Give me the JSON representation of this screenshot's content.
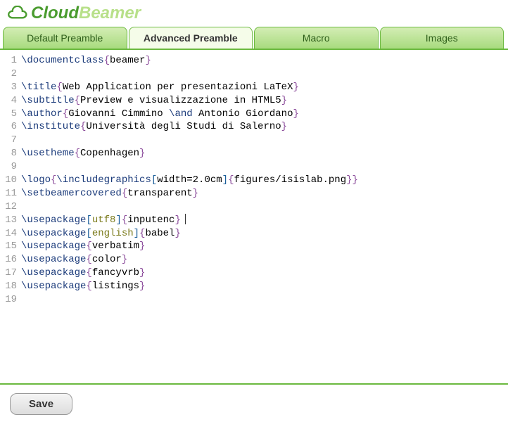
{
  "app": {
    "name_part1": "Cloud",
    "name_part2": "Beamer"
  },
  "tabs": [
    {
      "label": "Default Preamble",
      "active": false
    },
    {
      "label": "Advanced Preamble",
      "active": true
    },
    {
      "label": "Macro",
      "active": false
    },
    {
      "label": "Images",
      "active": false
    }
  ],
  "editor": {
    "line_count": 19,
    "lines": [
      [
        {
          "t": "cmd",
          "v": "\\documentclass"
        },
        {
          "t": "brace",
          "v": "{"
        },
        {
          "t": "txt",
          "v": "beamer"
        },
        {
          "t": "brace",
          "v": "}"
        }
      ],
      [],
      [
        {
          "t": "cmd",
          "v": "\\title"
        },
        {
          "t": "brace",
          "v": "{"
        },
        {
          "t": "txt",
          "v": "Web Application per presentazioni LaTeX"
        },
        {
          "t": "brace",
          "v": "}"
        }
      ],
      [
        {
          "t": "cmd",
          "v": "\\subtitle"
        },
        {
          "t": "brace",
          "v": "{"
        },
        {
          "t": "txt",
          "v": "Preview e visualizzazione in HTML5"
        },
        {
          "t": "brace",
          "v": "}"
        }
      ],
      [
        {
          "t": "cmd",
          "v": "\\author"
        },
        {
          "t": "brace",
          "v": "{"
        },
        {
          "t": "txt",
          "v": "Giovanni Cimmino "
        },
        {
          "t": "cmd",
          "v": "\\and"
        },
        {
          "t": "txt",
          "v": " Antonio Giordano"
        },
        {
          "t": "brace",
          "v": "}"
        }
      ],
      [
        {
          "t": "cmd",
          "v": "\\institute"
        },
        {
          "t": "brace",
          "v": "{"
        },
        {
          "t": "txt",
          "v": "Università degli Studi di Salerno"
        },
        {
          "t": "brace",
          "v": "}"
        }
      ],
      [],
      [
        {
          "t": "cmd",
          "v": "\\usetheme"
        },
        {
          "t": "brace",
          "v": "{"
        },
        {
          "t": "txt",
          "v": "Copenhagen"
        },
        {
          "t": "brace",
          "v": "}"
        }
      ],
      [],
      [
        {
          "t": "cmd",
          "v": "\\logo"
        },
        {
          "t": "brace",
          "v": "{"
        },
        {
          "t": "cmd",
          "v": "\\includegraphics"
        },
        {
          "t": "bracket",
          "v": "["
        },
        {
          "t": "txt",
          "v": "width=2.0cm"
        },
        {
          "t": "bracket",
          "v": "]"
        },
        {
          "t": "brace",
          "v": "{"
        },
        {
          "t": "txt",
          "v": "figures/isislab.png"
        },
        {
          "t": "brace",
          "v": "}"
        },
        {
          "t": "brace",
          "v": "}"
        }
      ],
      [
        {
          "t": "cmd",
          "v": "\\setbeamercovered"
        },
        {
          "t": "brace",
          "v": "{"
        },
        {
          "t": "txt",
          "v": "transparent"
        },
        {
          "t": "brace",
          "v": "}"
        }
      ],
      [],
      [
        {
          "t": "cmd",
          "v": "\\usepackage"
        },
        {
          "t": "bracket",
          "v": "["
        },
        {
          "t": "opt",
          "v": "utf8"
        },
        {
          "t": "bracket",
          "v": "]"
        },
        {
          "t": "brace",
          "v": "{"
        },
        {
          "t": "txt",
          "v": "inputenc"
        },
        {
          "t": "brace",
          "v": "}"
        },
        {
          "t": "cursor",
          "v": ""
        }
      ],
      [
        {
          "t": "cmd",
          "v": "\\usepackage"
        },
        {
          "t": "bracket",
          "v": "["
        },
        {
          "t": "opt",
          "v": "english"
        },
        {
          "t": "bracket",
          "v": "]"
        },
        {
          "t": "brace",
          "v": "{"
        },
        {
          "t": "txt",
          "v": "babel"
        },
        {
          "t": "brace",
          "v": "}"
        }
      ],
      [
        {
          "t": "cmd",
          "v": "\\usepackage"
        },
        {
          "t": "brace",
          "v": "{"
        },
        {
          "t": "txt",
          "v": "verbatim"
        },
        {
          "t": "brace",
          "v": "}"
        }
      ],
      [
        {
          "t": "cmd",
          "v": "\\usepackage"
        },
        {
          "t": "brace",
          "v": "{"
        },
        {
          "t": "txt",
          "v": "color"
        },
        {
          "t": "brace",
          "v": "}"
        }
      ],
      [
        {
          "t": "cmd",
          "v": "\\usepackage"
        },
        {
          "t": "brace",
          "v": "{"
        },
        {
          "t": "txt",
          "v": "fancyvrb"
        },
        {
          "t": "brace",
          "v": "}"
        }
      ],
      [
        {
          "t": "cmd",
          "v": "\\usepackage"
        },
        {
          "t": "brace",
          "v": "{"
        },
        {
          "t": "txt",
          "v": "listings"
        },
        {
          "t": "brace",
          "v": "}"
        }
      ],
      []
    ]
  },
  "footer": {
    "save_label": "Save"
  }
}
